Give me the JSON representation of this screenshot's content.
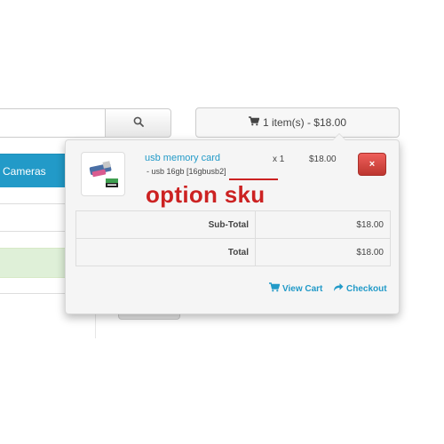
{
  "header": {
    "search": {
      "placeholder": ""
    },
    "cart_button_label": "1 item(s) - $18.00"
  },
  "sidebar": {
    "nav_item_label": "Cameras"
  },
  "cart": {
    "items": [
      {
        "name": "usb memory card",
        "option": "- usb 16gb [16gbusb2]",
        "quantity": "x 1",
        "price": "$18.00",
        "remove_label": "×"
      }
    ],
    "annotation": "option sku",
    "totals": [
      {
        "label": "Sub-Total",
        "value": "$18.00"
      },
      {
        "label": "Total",
        "value": "$18.00"
      }
    ],
    "view_cart_label": "View Cart",
    "checkout_label": "Checkout"
  },
  "colors": {
    "accent": "#229ac8",
    "danger": "#da4f49",
    "annotation": "#cc2222"
  }
}
